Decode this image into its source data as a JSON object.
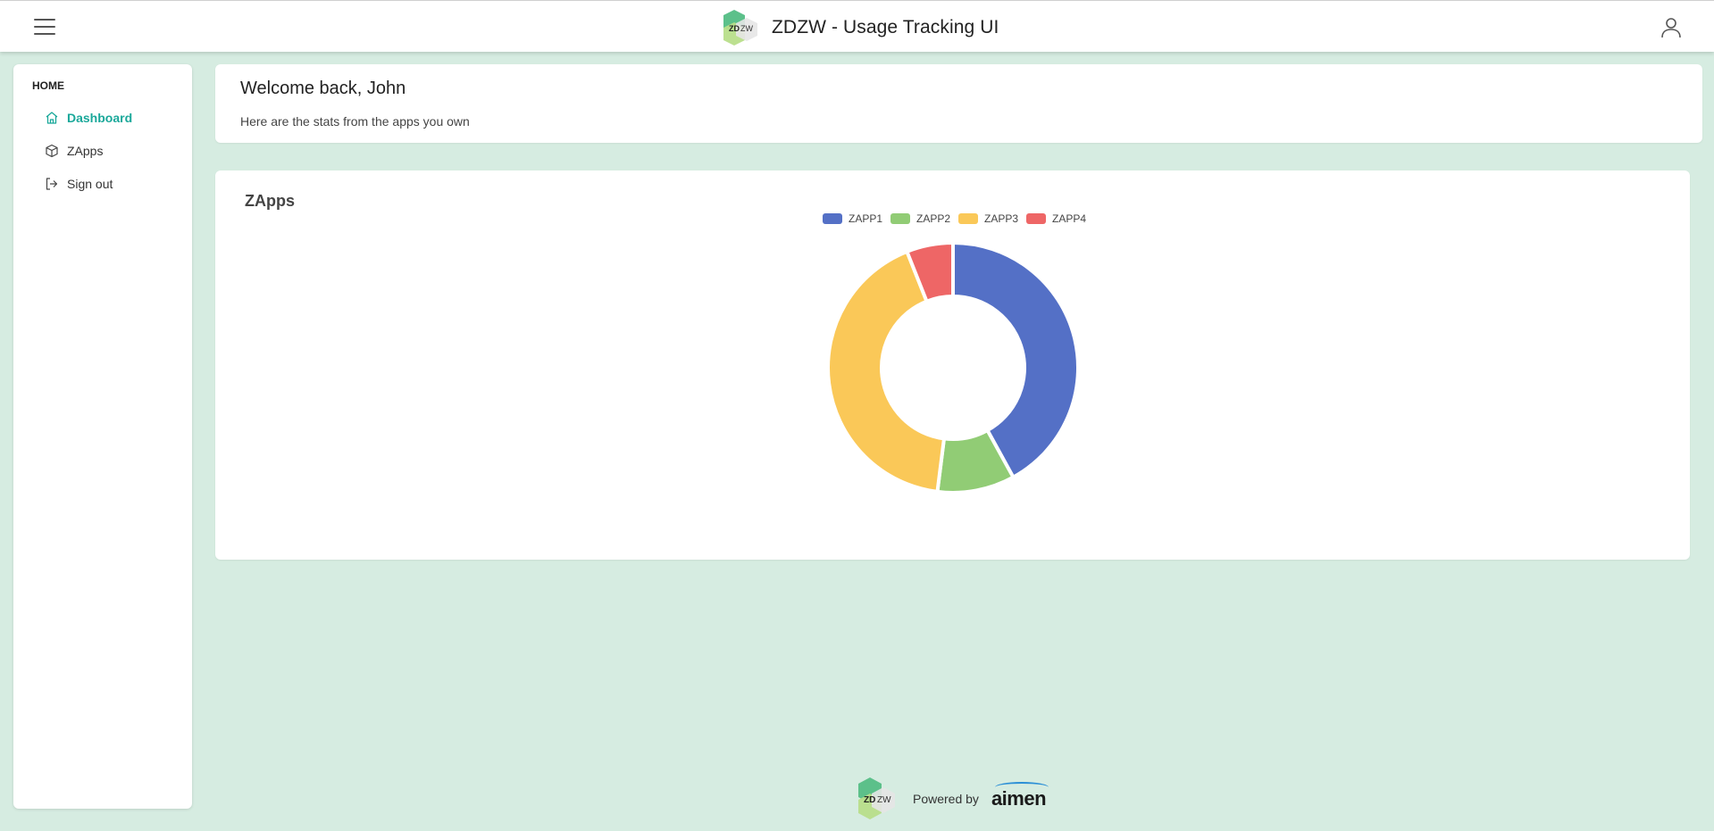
{
  "header": {
    "logo_text_a": "ZD",
    "logo_text_b": "ZW",
    "title": "ZDZW - Usage Tracking UI",
    "menu_icon": "hamburger-menu-icon",
    "user_icon": "user-account-icon"
  },
  "sidebar": {
    "section_label": "HOME",
    "items": [
      {
        "label": "Dashboard",
        "icon": "home-icon",
        "active": true
      },
      {
        "label": "ZApps",
        "icon": "cube-icon",
        "active": false
      },
      {
        "label": "Sign out",
        "icon": "sign-out-icon",
        "active": false
      }
    ]
  },
  "welcome": {
    "title": "Welcome back, John",
    "subtitle": "Here are the stats from the apps you own"
  },
  "zapps_card": {
    "title": "ZApps"
  },
  "chart_data": {
    "type": "pie",
    "variant": "doughnut",
    "categories": [
      "ZAPP1",
      "ZAPP2",
      "ZAPP3",
      "ZAPP4"
    ],
    "values": [
      42,
      10,
      42,
      6
    ],
    "colors": [
      "#5470c6",
      "#91cc75",
      "#fac858",
      "#ee6666"
    ],
    "legend_position": "top",
    "title": ""
  },
  "footer": {
    "powered_by": "Powered by",
    "partner": "aimen"
  },
  "colors": {
    "accent": "#1aa89a",
    "background": "#d6ece1"
  }
}
